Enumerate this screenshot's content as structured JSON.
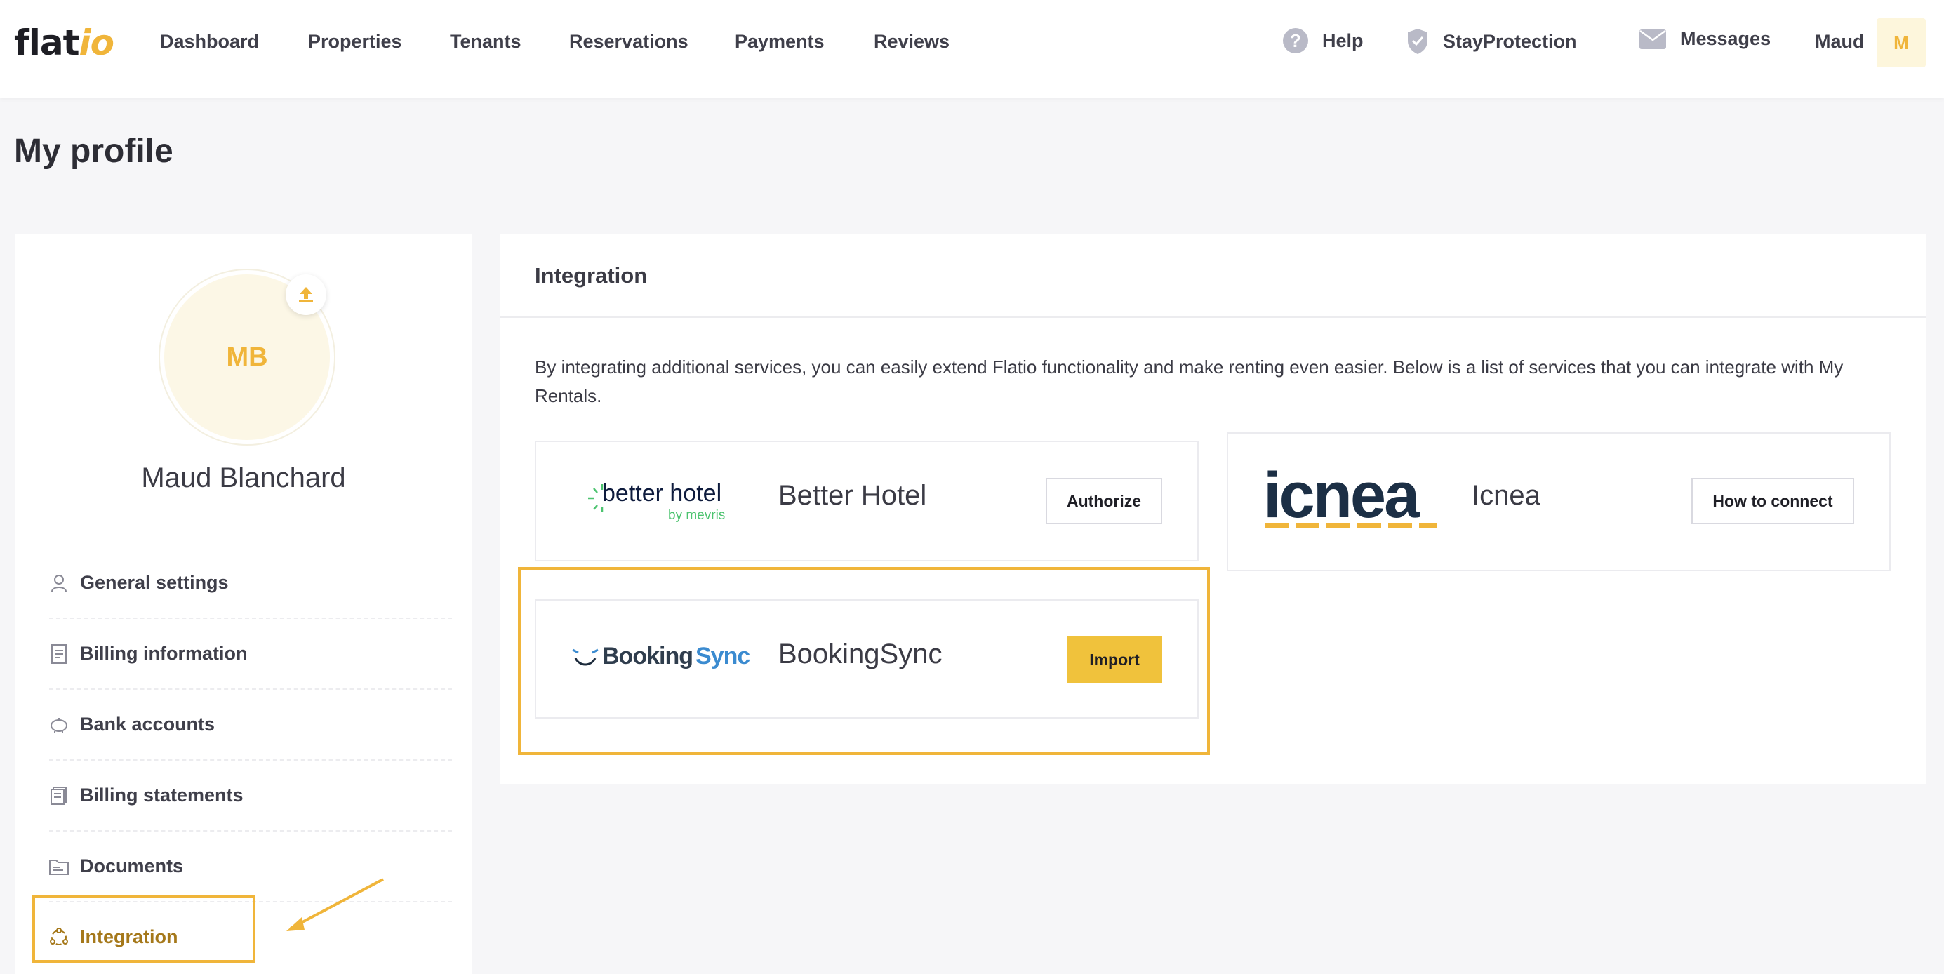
{
  "brand": {
    "logo_main": "flat",
    "logo_accent": "io"
  },
  "nav": {
    "items": [
      {
        "label": "Dashboard"
      },
      {
        "label": "Properties"
      },
      {
        "label": "Tenants"
      },
      {
        "label": "Reservations"
      },
      {
        "label": "Payments"
      },
      {
        "label": "Reviews"
      }
    ],
    "help": "Help",
    "stay_protection": "StayProtection",
    "messages": "Messages",
    "user_short": "Maud",
    "user_initial": "M"
  },
  "page": {
    "title": "My profile"
  },
  "profile": {
    "initials": "MB",
    "name": "Maud Blanchard",
    "menu": [
      {
        "label": "General settings",
        "icon": "user-icon"
      },
      {
        "label": "Billing information",
        "icon": "document-icon"
      },
      {
        "label": "Bank accounts",
        "icon": "piggy-bank-icon"
      },
      {
        "label": "Billing statements",
        "icon": "stack-icon"
      },
      {
        "label": "Documents",
        "icon": "folder-icon"
      },
      {
        "label": "Integration",
        "icon": "integration-icon",
        "active": true
      }
    ]
  },
  "integration": {
    "title": "Integration",
    "intro": "By integrating additional services, you can easily extend Flatio functionality and make renting even easier. Below is a list of services that you can integrate with My Rentals.",
    "services": [
      {
        "name": "Better Hotel",
        "logo_text": "better hotel",
        "logo_sub": "by mevris",
        "button": "Authorize"
      },
      {
        "name": "Icnea",
        "logo_text": "icnea",
        "button": "How to connect"
      },
      {
        "name": "BookingSync",
        "logo_text_a": "Booking",
        "logo_text_b": "Sync",
        "button": "Import"
      }
    ]
  },
  "colors": {
    "accent": "#f0b53a",
    "primary_button": "#f0c23c",
    "icnea_navy": "#1c2f45"
  }
}
